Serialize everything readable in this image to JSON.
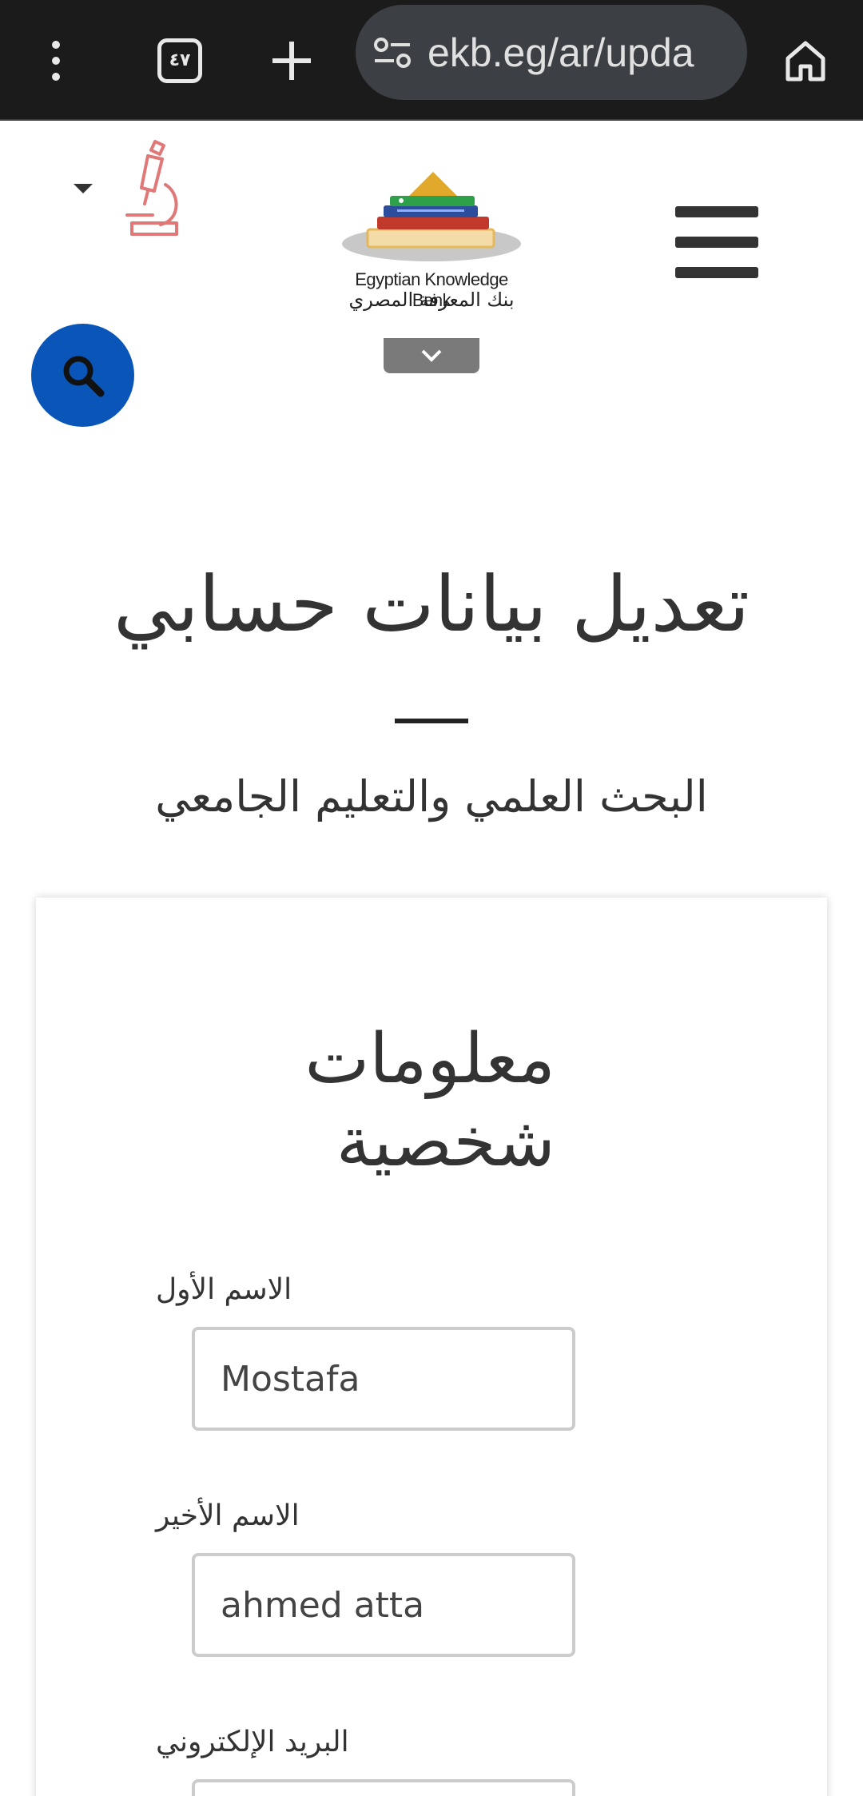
{
  "browser": {
    "tab_count": "٤٧",
    "url": "ekb.eg/ar/upda"
  },
  "header": {
    "logo_en": "Egyptian Knowledge Bank",
    "logo_ar": "بنك المعرفة المصري",
    "icons": [
      "hamburger-menu-icon",
      "microscope-icon",
      "caret-down-icon",
      "search-icon",
      "chevron-down-icon"
    ],
    "accent_color": "#0a55b8"
  },
  "page": {
    "title": "تعديل بيانات حسابي",
    "subtitle": "البحث العلمي والتعليم الجامعي"
  },
  "form": {
    "section_title": "معلومات شخصية",
    "fields": [
      {
        "label": "الاسم الأول",
        "value": "Mostafa"
      },
      {
        "label": "الاسم الأخير",
        "value": "ahmed atta"
      },
      {
        "label": "البريد الإلكتروني",
        "value": ""
      }
    ]
  }
}
